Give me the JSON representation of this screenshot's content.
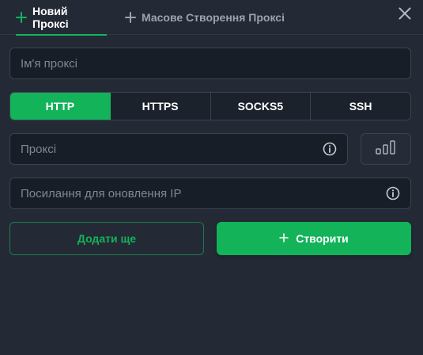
{
  "tabs": [
    {
      "label": "Новий Проксі",
      "icon": "plus-icon",
      "active": true
    },
    {
      "label": "Масове Створення Проксі",
      "icon": "plus-icon",
      "active": false
    }
  ],
  "close_icon": "close-icon",
  "name_field": {
    "placeholder": "Ім'я проксі",
    "value": ""
  },
  "protocols": [
    {
      "label": "HTTP",
      "active": true
    },
    {
      "label": "HTTPS",
      "active": false
    },
    {
      "label": "SOCKS5",
      "active": false
    },
    {
      "label": "SSH",
      "active": false
    }
  ],
  "proxy_field": {
    "placeholder": "Проксі",
    "value": "",
    "icon": "info-icon"
  },
  "check_button": {
    "icon": "signal-bars-icon"
  },
  "refresh_field": {
    "placeholder": "Посилання для оновлення IP",
    "value": "",
    "icon": "info-icon"
  },
  "add_more_button": {
    "label": "Додати ще"
  },
  "create_button": {
    "label": "Створити",
    "icon": "plus-icon"
  },
  "colors": {
    "accent": "#13b35a",
    "background": "#232a35",
    "input_bg": "#181e27",
    "border": "#3a4350"
  }
}
